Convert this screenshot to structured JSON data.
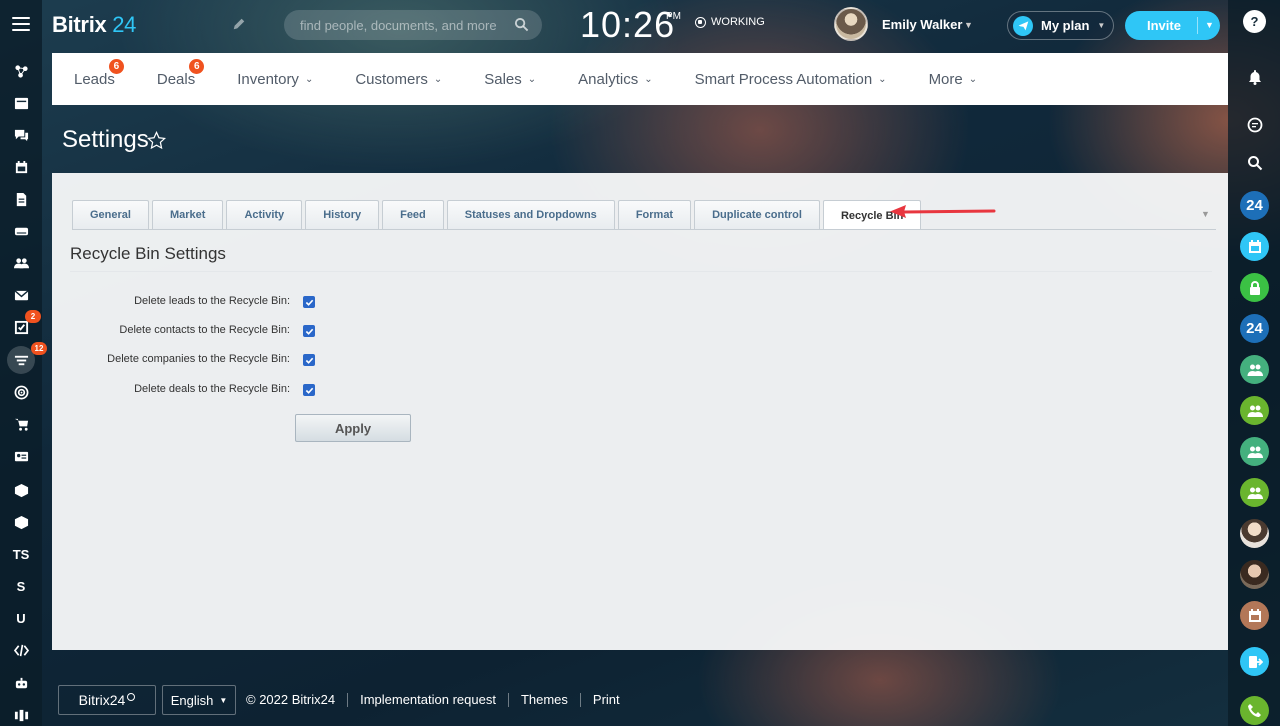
{
  "header": {
    "logo_text": "Bitrix",
    "logo_num": "24",
    "search_placeholder": "find people, documents, and more",
    "clock": "10:26",
    "clock_suffix": "PM",
    "status": "WORKING",
    "user_name": "Emily Walker",
    "myplan_label": "My plan",
    "invite_label": "Invite"
  },
  "top_nav": [
    {
      "label": "Leads",
      "badge": "6"
    },
    {
      "label": "Deals",
      "badge": "6"
    },
    {
      "label": "Inventory"
    },
    {
      "label": "Customers"
    },
    {
      "label": "Sales"
    },
    {
      "label": "Analytics"
    },
    {
      "label": "Smart Process Automation"
    },
    {
      "label": "More"
    }
  ],
  "page": {
    "title": "Settings"
  },
  "tabs": [
    {
      "label": "General"
    },
    {
      "label": "Market"
    },
    {
      "label": "Activity"
    },
    {
      "label": "History"
    },
    {
      "label": "Feed"
    },
    {
      "label": "Statuses and Dropdowns"
    },
    {
      "label": "Format"
    },
    {
      "label": "Duplicate control"
    },
    {
      "label": "Recycle Bin",
      "active": true
    }
  ],
  "recycle_bin": {
    "section_title": "Recycle Bin Settings",
    "options": [
      {
        "label": "Delete leads to the Recycle Bin:",
        "checked": true
      },
      {
        "label": "Delete contacts to the Recycle Bin:",
        "checked": true
      },
      {
        "label": "Delete companies to the Recycle Bin:",
        "checked": true
      },
      {
        "label": "Delete deals to the Recycle Bin:",
        "checked": true
      }
    ],
    "apply_label": "Apply"
  },
  "left_sidebar": {
    "badges": {
      "tasks": "2",
      "crm": "12"
    },
    "text_items": [
      "TS",
      "S",
      "U"
    ]
  },
  "right_sidebar": {
    "labels": {
      "b24_1": "24",
      "b24_2": "24",
      "help": "?"
    }
  },
  "footer": {
    "logo": "Bitrix24",
    "language": "English",
    "copyright": "© 2022 Bitrix24",
    "links": [
      "Implementation request",
      "Themes",
      "Print"
    ]
  },
  "colors": {
    "accent": "#2fc6f6",
    "badge": "#f0521f",
    "checkbox": "#2a67c9",
    "arrow": "#e8363f"
  }
}
